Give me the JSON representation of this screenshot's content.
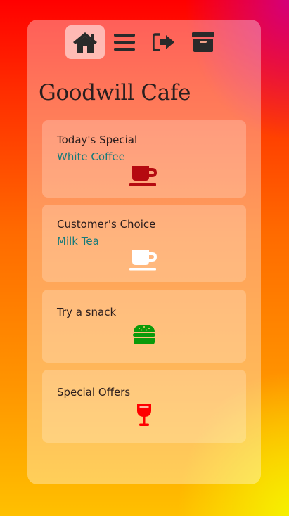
{
  "nav": {
    "items": [
      {
        "icon": "home-icon",
        "active": true
      },
      {
        "icon": "menu-icon",
        "active": false
      },
      {
        "icon": "sign-out-icon",
        "active": false
      },
      {
        "icon": "archive-icon",
        "active": false
      }
    ]
  },
  "page": {
    "title": "Goodwill Cafe"
  },
  "cards": [
    {
      "title": "Today's Special",
      "subtitle": "White Coffee",
      "icon": "coffee-cup-icon",
      "icon_color": "#b50a10"
    },
    {
      "title": "Customer's Choice",
      "subtitle": "Milk Tea",
      "icon": "coffee-cup-icon",
      "icon_color": "#ffffff"
    },
    {
      "title": "Try a snack",
      "icon": "burger-icon",
      "icon_color": "#0a9a0a"
    },
    {
      "title": "Special Offers",
      "icon": "wine-glass-icon",
      "icon_color": "#ff0000"
    }
  ],
  "colors": {
    "text": "#2b1d1d",
    "subtitle": "#177a7a",
    "nav_icon": "#2a2a2a"
  }
}
